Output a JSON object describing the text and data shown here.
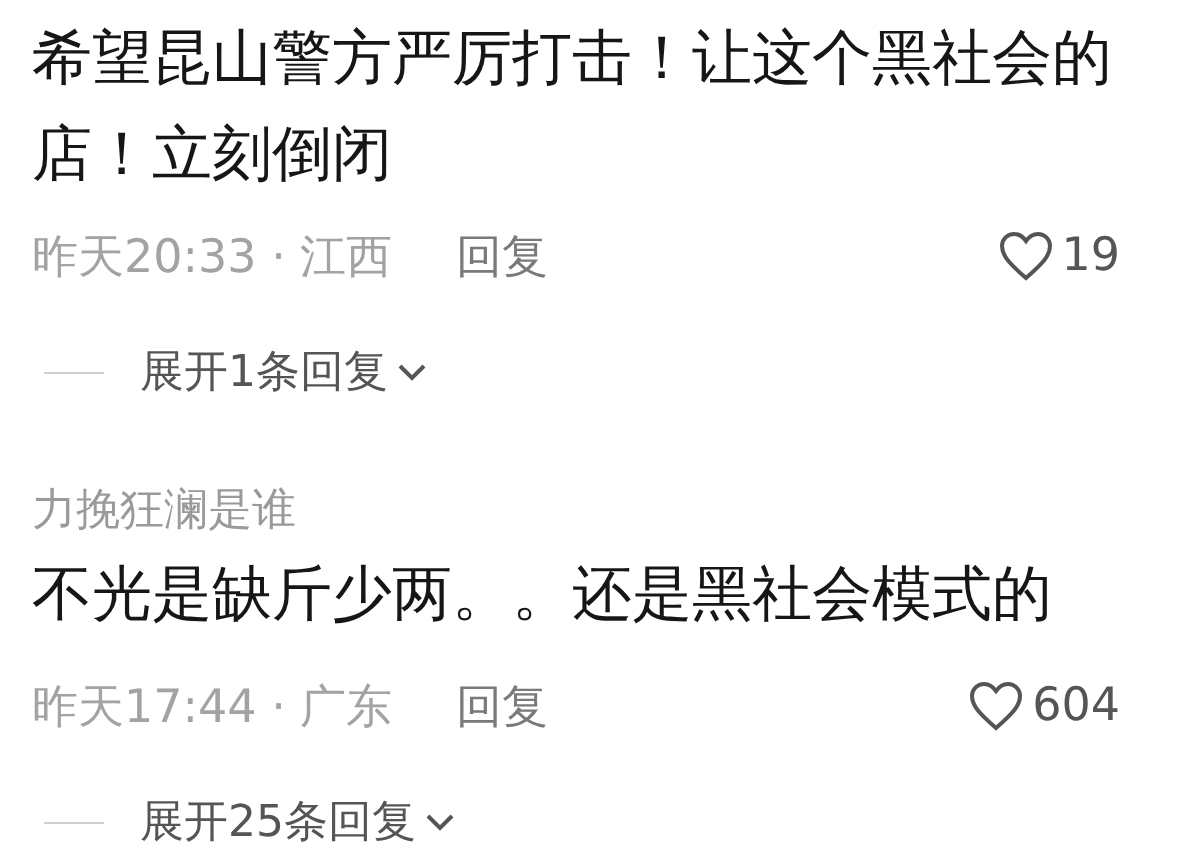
{
  "comments": [
    {
      "text": "希望昆山警方严厉打击！让这个黑社会的店！立刻倒闭",
      "time": "昨天20:33",
      "separator": "·",
      "location": "江西",
      "reply_label": "回复",
      "likes": "19",
      "expand_label": "展开1条回复"
    },
    {
      "username": "力挽狂澜是谁",
      "text": "不光是缺斤少两。。还是黑社会模式的",
      "time": "昨天17:44",
      "separator": "·",
      "location": "广东",
      "reply_label": "回复",
      "likes": "604",
      "expand_label": "展开25条回复"
    }
  ]
}
